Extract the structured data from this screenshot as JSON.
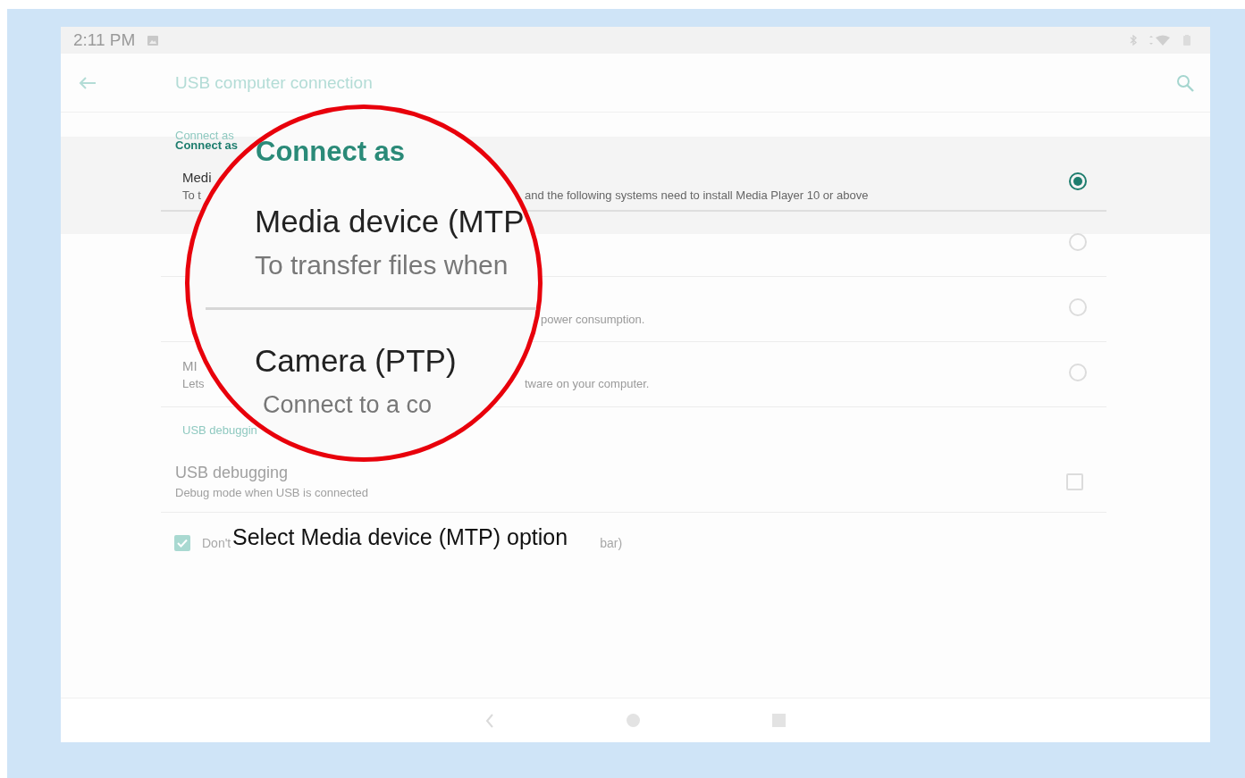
{
  "status_bar": {
    "time": "2:11 PM"
  },
  "app_bar": {
    "title": "USB computer connection"
  },
  "connect_as_header_ghost": "Connect as",
  "connect_as_header": "Connect as",
  "options": [
    {
      "title": "Medi",
      "subtitle_start": "To t",
      "subtitle_end": "and the following systems need to install Media Player 10 or above",
      "selected": true
    },
    {
      "selected": false
    },
    {
      "subtitle_end": "power consumption.",
      "selected": false
    },
    {
      "title": "MI",
      "subtitle_start": "Lets",
      "subtitle_end": "tware on your computer.",
      "selected": false
    }
  ],
  "usb_debugging_section": "USB debuggin",
  "usb_debugging": {
    "title": "USB debugging",
    "subtitle": "Debug mode when USB is connected",
    "checked": false
  },
  "dont_show_again": {
    "label_start": "Don't",
    "label_end": "bar)",
    "checked": true
  },
  "magnifier": {
    "header": "Connect as",
    "items": [
      {
        "title": "Media device (MTP",
        "subtitle": "To transfer files when"
      },
      {
        "title": "Camera (PTP)",
        "subtitle": "Connect to a co"
      }
    ]
  },
  "caption": "Select Media device (MTP) option"
}
